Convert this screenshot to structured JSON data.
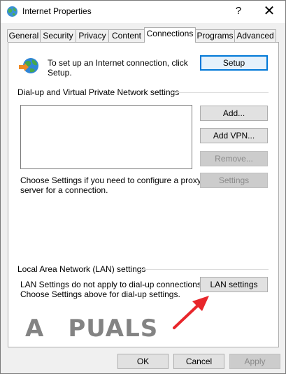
{
  "window": {
    "title": "Internet Properties",
    "help_glyph": "?",
    "close_glyph": "✕"
  },
  "tabs": [
    {
      "label": "General",
      "active": false
    },
    {
      "label": "Security",
      "active": false
    },
    {
      "label": "Privacy",
      "active": false
    },
    {
      "label": "Content",
      "active": false
    },
    {
      "label": "Connections",
      "active": true
    },
    {
      "label": "Programs",
      "active": false
    },
    {
      "label": "Advanced",
      "active": false
    }
  ],
  "setup_section": {
    "text_line1": "To set up an Internet connection, click",
    "text_line2": "Setup.",
    "setup_button": "Setup"
  },
  "dialup_section": {
    "label": "Dial-up and Virtual Private Network settings",
    "add_button": "Add...",
    "add_vpn_button": "Add VPN...",
    "remove_button": "Remove...",
    "settings_button": "Settings",
    "proxy_text_line1": "Choose Settings if you need to configure a proxy",
    "proxy_text_line2": "server for a connection."
  },
  "lan_section": {
    "label": "Local Area Network (LAN) settings",
    "text_line1": "LAN Settings do not apply to dial-up connections.",
    "text_line2": "Choose Settings above for dial-up settings.",
    "lan_button": "LAN settings"
  },
  "footer": {
    "ok_button": "OK",
    "cancel_button": "Cancel",
    "apply_button": "Apply"
  },
  "watermark": {
    "text_a": "A",
    "text_rest": "PUALS"
  },
  "colors": {
    "accent": "#0078d7",
    "arrow": "#e8262b"
  }
}
